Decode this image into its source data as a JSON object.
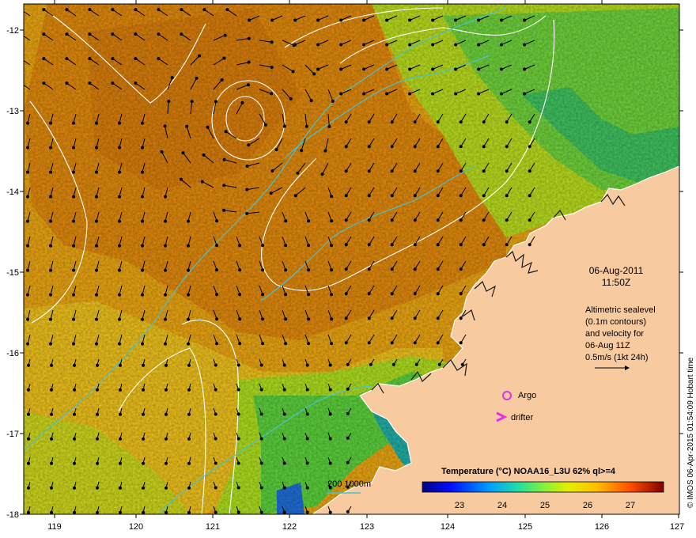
{
  "map": {
    "date_label": "06-Aug-2011",
    "time_label": "11:50Z",
    "longitude_ticks": [
      "119",
      "120",
      "121",
      "122",
      "123",
      "124",
      "125",
      "126",
      "127"
    ],
    "latitude_ticks": [
      "-12",
      "-13",
      "-14",
      "-15",
      "-16",
      "-17",
      "-18"
    ],
    "altimetry_note": [
      "Altimetric sealevel",
      "(0.1m contours)",
      "and velocity for",
      "06-Aug 11Z",
      "0.5m/s (1kt 24h)"
    ],
    "legend_argo": "Argo",
    "legend_drifter": "drifter",
    "depth_legend": "200  1000m",
    "colorbar_title": "Temperature (°C) NOAA16_L3U 62% ql>=4",
    "colorbar_ticks": [
      "23",
      "24",
      "25",
      "26",
      "27"
    ],
    "credit": "© IMOS 06-Apr-2015 01:54:09 Hobart time",
    "colors": {
      "land": "#f7caa0",
      "warm": "#d9880c",
      "mid": "#e6b21c",
      "cool": "#9bd81e",
      "green": "#3fbf3c",
      "isobath": "#49c2cf",
      "contour": "#ffffff",
      "argo": "#e52fe1"
    }
  }
}
